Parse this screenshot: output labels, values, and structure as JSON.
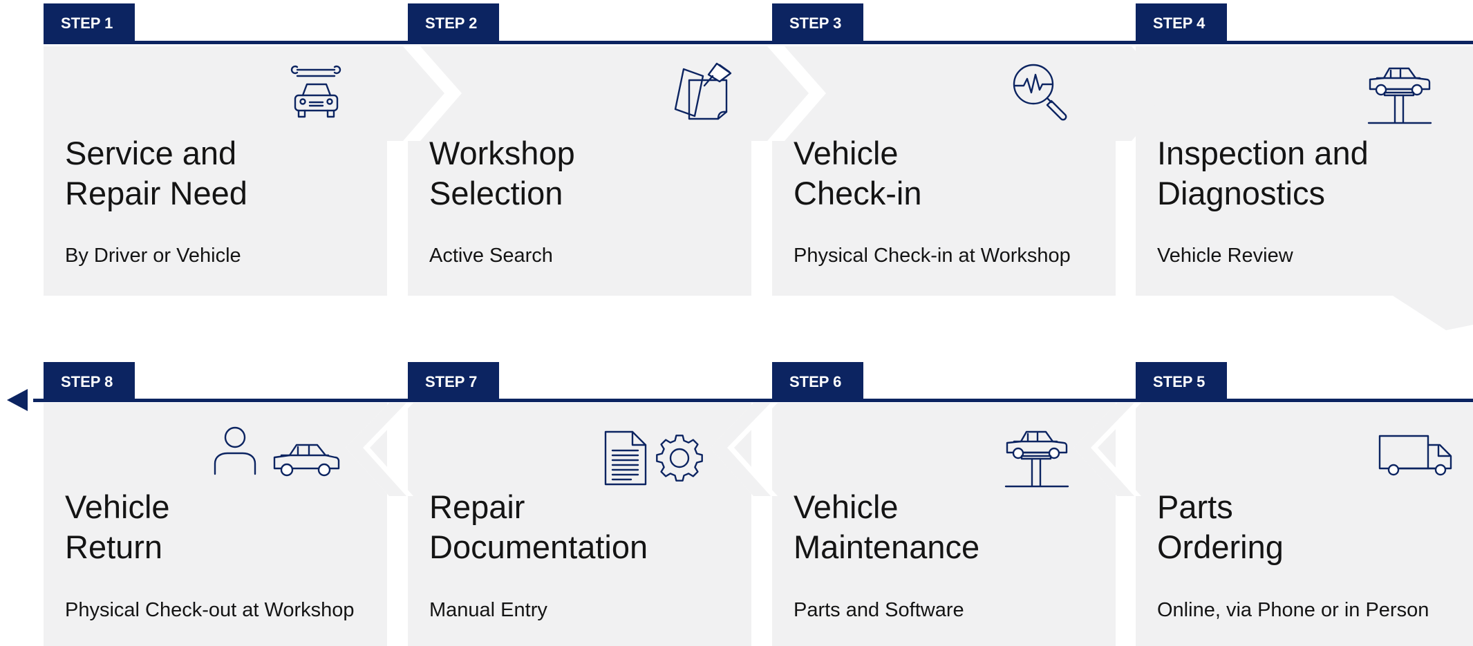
{
  "colors": {
    "accent": "#0c2461",
    "panel": "#f1f1f2",
    "text": "#141414"
  },
  "steps": [
    {
      "tag": "STEP 1",
      "title": [
        "Service and",
        "Repair Need"
      ],
      "subtitle": "By Driver or Vehicle",
      "icons": [
        "car-with-wrench-icon"
      ]
    },
    {
      "tag": "STEP 2",
      "title": [
        "Workshop",
        "Selection"
      ],
      "subtitle": "Active Search",
      "icons": [
        "pinned-notes-icon"
      ]
    },
    {
      "tag": "STEP 3",
      "title": [
        "Vehicle",
        "Check-in"
      ],
      "subtitle": "Physical Check-in at Workshop",
      "icons": [
        "diagnostic-magnifier-icon"
      ]
    },
    {
      "tag": "STEP 4",
      "title": [
        "Inspection and",
        "Diagnostics"
      ],
      "subtitle": "Vehicle Review",
      "icons": [
        "car-on-lift-icon"
      ]
    },
    {
      "tag": "STEP 5",
      "title": [
        "Parts",
        "Ordering"
      ],
      "subtitle": "Online, via Phone or in Person",
      "icons": [
        "delivery-truck-icon"
      ]
    },
    {
      "tag": "STEP 6",
      "title": [
        "Vehicle",
        "Maintenance"
      ],
      "subtitle": "Parts and Software",
      "icons": [
        "car-on-lift-icon"
      ]
    },
    {
      "tag": "STEP 7",
      "title": [
        "Repair",
        "Documentation"
      ],
      "subtitle": "Manual Entry",
      "icons": [
        "document-icon",
        "gear-icon"
      ]
    },
    {
      "tag": "STEP 8",
      "title": [
        "Vehicle",
        "Return"
      ],
      "subtitle": "Physical Check-out at Workshop",
      "icons": [
        "person-icon",
        "car-icon"
      ]
    }
  ]
}
